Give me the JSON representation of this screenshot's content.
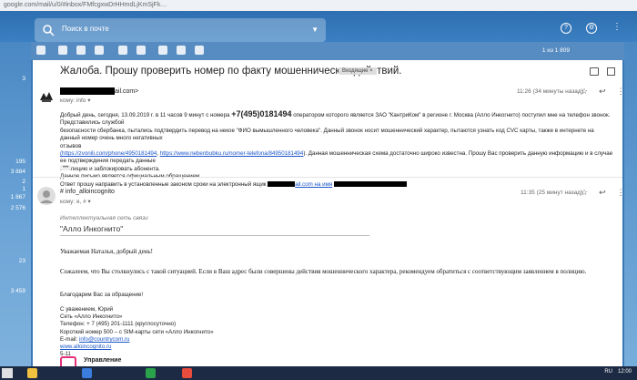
{
  "browser": {
    "url_fragment": "google.com/mail/u/0/#inbox/FMfcgxwDrHHmdLjKmSjFk…"
  },
  "header": {
    "search_placeholder": "Поиск в почте",
    "icons": [
      "help-icon",
      "settings-icon",
      "apps-icon"
    ]
  },
  "left_counts": [
    "3",
    "195",
    "3 884",
    "2",
    "1",
    "1 867",
    "2 576",
    "23",
    "3 459"
  ],
  "toolbar": {
    "pager": "1 из 1 809"
  },
  "subject": {
    "text": "Жалоба. Прошу проверить номер по факту мошеннических действий.",
    "badge": "Входящие ×"
  },
  "msg1": {
    "sender_suffix": "ail.com>",
    "to": "кому: info ▾",
    "time": "11:26 (34 минуты назад)",
    "line1_a": "Добрый день, сегодня, 13.09.2019 г. в 11 часов 9 минут с номера",
    "phone": "+7(495)0181494",
    "line1_b": "оператором которого является ЗАО \"КантриКом\" в регионе г. Москва (Алло Инкогнито) поступил мне на телефон звонок. Представились службой",
    "line2": "безопасности сбербанка, пытались подтвердить перевод на некое \"ФИО вымышленного человека\". Данный звонок носит мошеннический характер, пытаются узнать код CVC карты, также в интернете на данный номер очень много негативных",
    "line3": "отзывов",
    "link1": "(https://zvonili.com/phone/4950181494",
    "link2": "https://www.nebenbubku.ru/nomer-telefona/84950181494",
    "line4_tail": "). Данная мошенническая схема достаточно широко известна. Прошу Вас проверить данную информацию и в случае ее подтверждения передать данные",
    "line5": "в полицию и заблокировать абонента.",
    "line6": "Данное письмо является официальным обращением.",
    "line7_a": "Ответ прошу направить в установленные законом сроки на электронный ящик",
    "line7_mid": "ail.com на имя",
    "dots": "•••"
  },
  "msg2": {
    "sender": "# info_alloincognito",
    "to": "кому: я, # ▾",
    "time": "11:35 (25 минут назад)",
    "org_italic": "Интеллектуальная сеть связи",
    "org_name": "\"Алло Инкогнито\"",
    "greeting": "Уважаемая Наталья, добрый день!",
    "sorry": "Сожалеем, что Вы столкнулись с такой ситуацией. Если в Ваш адрес были совершены действия мошеннического характера, рекомендуем обратиться с соответствующим заявлением в полицию.",
    "thanks": "Благодарим Вас за обращение!",
    "sig1": "С уважением, Юрий",
    "sig2": "Сеть «Алло Инкогнито»",
    "sig3": "Телефон: + 7 (495) 201-1111 (круглосуточно)",
    "sig4": "Короткий номер 500 – с SIM-карты сети «Алло Инкогнито»",
    "sig5_label": "E-mail:",
    "sig5_link": "info@countrycom.ru",
    "sig6": "www.alloincognito.ru",
    "sig7": "5-11",
    "logo_text": "Управление"
  },
  "taskbar": {
    "lang": "RU",
    "time": "12:00"
  }
}
